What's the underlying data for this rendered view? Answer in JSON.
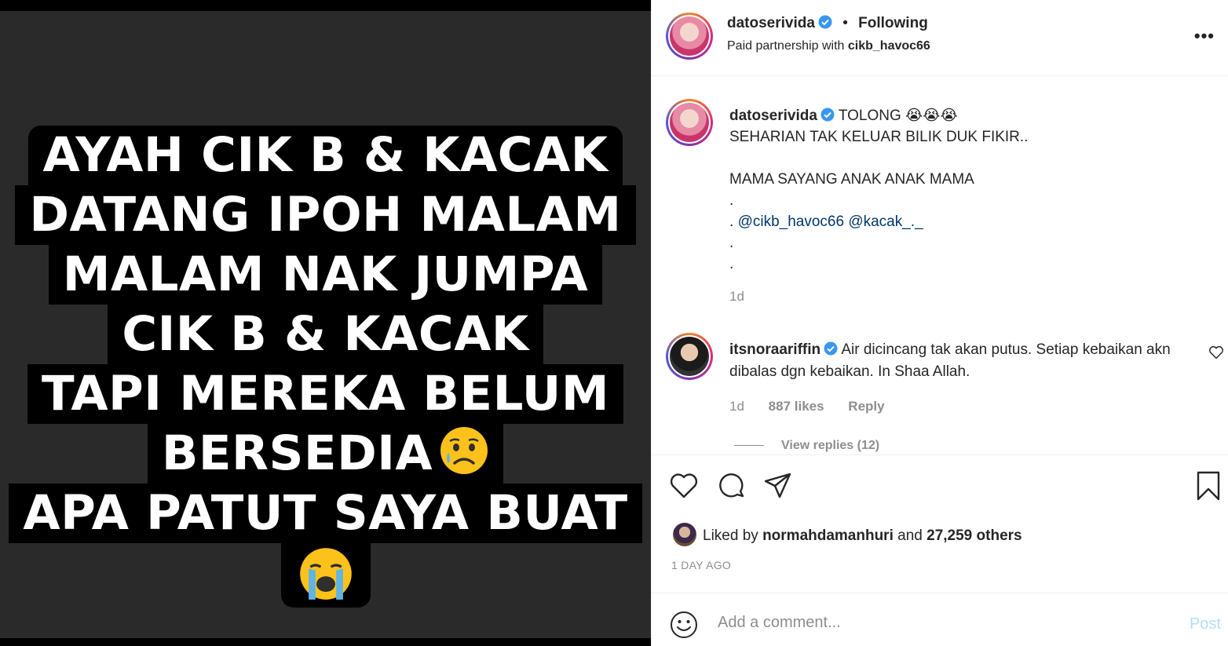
{
  "story": {
    "lines": [
      "AYAH CIK B & KACAK",
      "DATANG IPOH MALAM",
      "MALAM NAK JUMPA",
      "CIK B & KACAK",
      "TAPI MEREKA BELUM",
      "BERSEDIA",
      "APA PATUT SAYA BUAT"
    ],
    "emoji_sad": "sad-face-emoji",
    "emoji_cry": "loudly-crying-emoji"
  },
  "header": {
    "username": "datoserivida",
    "separator": "•",
    "following": "Following",
    "paid_prefix": "Paid partnership with",
    "partner": "cikb_havoc66",
    "more": "•••"
  },
  "caption": {
    "username": "datoserivida",
    "title": "TOLONG",
    "emojis": "😭😭😭",
    "line1": "SEHARIAN TAK KELUAR BILIK DUK FIKIR..",
    "line2": "MAMA SAYANG ANAK ANAK MAMA",
    "dot": ".",
    "dot_prefix": ". ",
    "mention1": "@cikb_havoc66",
    "mention2": "@kacak_._",
    "age": "1d"
  },
  "comment": {
    "username": "itsnoraariffin",
    "text": "Air dicincang tak akan putus. Setiap kebaikan akn dibalas dgn kebaikan. In Shaa Allah.",
    "age": "1d",
    "likes": "887 likes",
    "reply": "Reply",
    "view_replies": "View replies (12)"
  },
  "likes": {
    "prefix": "Liked by",
    "user": "normahdamanhuri",
    "and": "and",
    "others": "27,259 others"
  },
  "timestamp": "1 DAY AGO",
  "add_comment": {
    "placeholder": "Add a comment...",
    "post": "Post"
  },
  "colors": {
    "verified": "#3897f0",
    "mention": "#00376b",
    "muted": "#8e8e8e",
    "post_disabled": "#b2dffc"
  }
}
